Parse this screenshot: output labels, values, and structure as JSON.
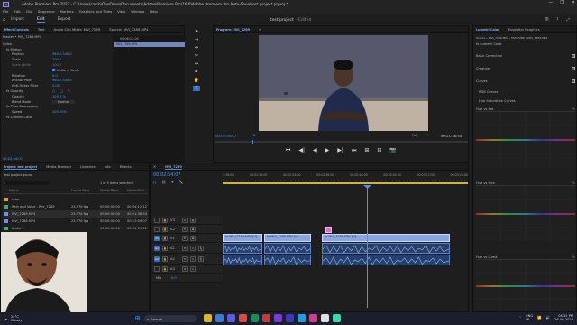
{
  "window": {
    "title": "Adobe Premiere Pro 2022 - C:\\Users\\sarch\\OneDrive\\Documents\\Adobe\\Premiere Pro\\16.0\\Adobe Premiere Pro Auto-Save\\test project.prproj *",
    "app_badge": "Pr",
    "controls": [
      "—",
      "❐",
      "✕"
    ]
  },
  "menu": [
    "File",
    "Edit",
    "Clip",
    "Sequence",
    "Markers",
    "Graphics and Titles",
    "View",
    "Window",
    "Help"
  ],
  "workspace": {
    "tabs": [
      "Import",
      "Edit",
      "Export"
    ],
    "active_tab": "Edit",
    "project_name": "test project",
    "project_state": "- Edited"
  },
  "effect_controls": {
    "tabs": [
      "Effect Controls",
      "Text",
      "Audio Clip Mixer: MVI_7289",
      "Source: MVI_7289.MP4"
    ],
    "master": "Master • MVI_7289.MP4",
    "clip_time": "00:06:12:00",
    "clip_name": "MVI_7289.MP4",
    "section_video": "Video",
    "rows": [
      {
        "label": "fx  Motion",
        "value": ""
      },
      {
        "label": "Position",
        "value": "960.0   540.0"
      },
      {
        "label": "Scale",
        "value": "100.0"
      },
      {
        "label": "Scale Width",
        "value": "100.0"
      },
      {
        "label": "",
        "value": "Uniform Scale"
      },
      {
        "label": "Rotation",
        "value": "0.0"
      },
      {
        "label": "Anchor Point",
        "value": "960.0   540.0"
      },
      {
        "label": "Anti-flicker Filter",
        "value": "0.00"
      },
      {
        "label": "fx  Opacity",
        "value": ""
      },
      {
        "label": "Opacity",
        "value": "100.0 %"
      },
      {
        "label": "Blend Mode",
        "value": "Normal"
      },
      {
        "label": "fx  Time Remapping",
        "value": ""
      },
      {
        "label": "Speed",
        "value": "100.00%"
      },
      {
        "label": "fx  Lumetri Color",
        "value": ""
      }
    ],
    "timecode": "00:02:54:07"
  },
  "program": {
    "tabs": [
      "Program: MVI_7289",
      "≡"
    ],
    "timecode": "00:02:54:07",
    "fit": "Fit",
    "quality": "Full",
    "duration": "00:21:38:54",
    "controls": [
      "⏮",
      "◀|",
      "◀",
      "▶",
      "▶|",
      "⏭",
      "⊞",
      "⊟",
      "📷"
    ]
  },
  "project": {
    "tabs": [
      "Project: test project",
      "Media Browser",
      "Libraries",
      "Info",
      "Effects"
    ],
    "file": "test project.prproj",
    "items_selected": "1 of 5 items selected",
    "columns": [
      "Name",
      "Frame Rate",
      "Media Start",
      "Media End"
    ],
    "rows": [
      {
        "name": "scan",
        "rate": "",
        "start": "",
        "end": ""
      },
      {
        "name": "Rain and Voice - Rec_7289",
        "rate": "23.976 fps",
        "start": "00:00:00:00",
        "end": "00:04:12:12"
      },
      {
        "name": "MVI_7289.MP4",
        "rate": "23.976 fps",
        "start": "00:00:00:00",
        "end": "00:21:38:54"
      },
      {
        "name": "MVI_7288.MP4",
        "rate": "23.976 fps",
        "start": "00:00:00:00",
        "end": "00:12:04:07"
      },
      {
        "name": "Audio 1",
        "rate": "",
        "start": "00:00:00:00",
        "end": "00:01:21:11"
      }
    ]
  },
  "timeline": {
    "tab": "MVI_7289",
    "timecode": "00:02:54:07",
    "ruler": [
      "1:36:00",
      "00:02:12:00",
      "00:02:24:00",
      "00:02:36:00",
      "00:02:48:00",
      "00:03:00:00",
      "00:03:12:00",
      "00:03:24:00"
    ],
    "tracks_v": [
      "V3",
      "V2",
      "V1"
    ],
    "tracks_a": [
      "A1",
      "A2",
      "A3",
      "Mix"
    ],
    "mix_value": "0.0",
    "clips": [
      {
        "name": "fx  MVI_7289.MP4 [V]"
      },
      {
        "name": "fx  MVI_7289.MP4 [V]"
      },
      {
        "name": "fx  MVI_7289.MP4 [V]"
      }
    ]
  },
  "lumetri": {
    "tabs": [
      "Lumetri Color",
      "Essential Graphics"
    ],
    "source": "Source • MVI_7289.MP4  ›  MVI_7289 • MVI_7289.MP4",
    "effect": "fx  Lumetri Color",
    "sections": [
      "Basic Correction",
      "Creative",
      "Curves"
    ],
    "rgb_curves": "RGB Curves",
    "hsl_curves": "Hue Saturation Curves",
    "curve_titles": [
      "Hue vs Sat",
      "Hue vs Hue",
      "Hue vs Luma"
    ]
  },
  "taskbar": {
    "weather_temp": "24°C",
    "weather_text": "Cloudy",
    "search": "Search",
    "lang": "ENG\nIN",
    "time": "04:31 PM",
    "date": "26-06-2023"
  },
  "colors": {
    "accent": "#3a8bff",
    "clip_video": "#8aa6de",
    "clip_audio": "#26406d",
    "playhead": "#4f8cff"
  }
}
